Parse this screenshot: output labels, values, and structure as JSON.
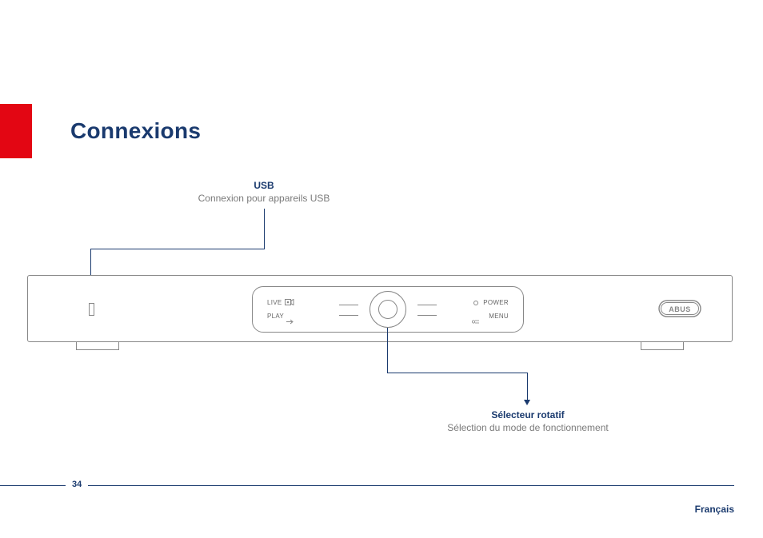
{
  "page": {
    "title": "Connexions",
    "number": "34",
    "language": "Français"
  },
  "callouts": {
    "usb": {
      "title": "USB",
      "desc": "Connexion pour appareils USB"
    },
    "rotary": {
      "title": "Sélecteur rotatif",
      "desc": "Sélection du mode de fonctionnement"
    }
  },
  "device": {
    "brand": "ABUS",
    "panel": {
      "live": "LIVE",
      "play": "PLAY",
      "power": "POWER",
      "menu": "MENU"
    }
  }
}
